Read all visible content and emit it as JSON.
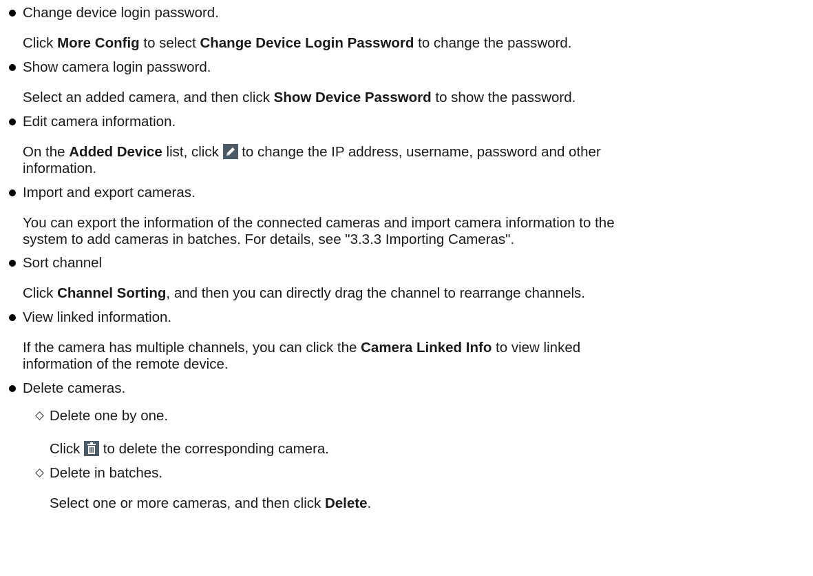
{
  "items": [
    {
      "title": "Change device login password.",
      "desc_parts": [
        "Click ",
        "More Config",
        "  to select ",
        "Change Device Login Password",
        " to change the password."
      ]
    },
    {
      "title": "Show camera login password.",
      "desc_parts": [
        "Select an added camera, and then click ",
        "Show Device Password",
        "  to show the password."
      ]
    },
    {
      "title": "Edit camera information.",
      "desc_parts": [
        "On the ",
        "Added Device",
        "  list, click ",
        " to change the IP address, username, password and other"
      ],
      "desc_line2": "information.",
      "icon": "pencil-edit-icon"
    },
    {
      "title": "Import and export cameras.",
      "desc_line1": "You can export the information of the connected cameras and import camera information to the",
      "desc_line2": "system to add cameras in batches. For details, see \"3.3.3 Importing Cameras\"."
    },
    {
      "title": "Sort channel",
      "desc_parts": [
        "Click ",
        "Channel Sorting",
        ", and then you can directly drag the channel to rearrange channels."
      ]
    },
    {
      "title": "View linked information.",
      "desc_parts": [
        "If the camera has multiple channels, you can click the ",
        "Camera Linked Info",
        "  to view linked"
      ],
      "desc_line2": "information of the remote device."
    },
    {
      "title": "Delete cameras.",
      "sub_items": [
        {
          "title": "Delete one by one.",
          "desc_parts": [
            "Click ",
            " to delete the corresponding camera."
          ],
          "icon": "trash-delete-icon"
        },
        {
          "title": "Delete in batches.",
          "desc_parts": [
            "Select one or more cameras, and then click ",
            "Delete",
            "."
          ]
        }
      ]
    }
  ],
  "colors": {
    "text": "#1a1a1a",
    "icon_bg": "#4a5a66"
  }
}
